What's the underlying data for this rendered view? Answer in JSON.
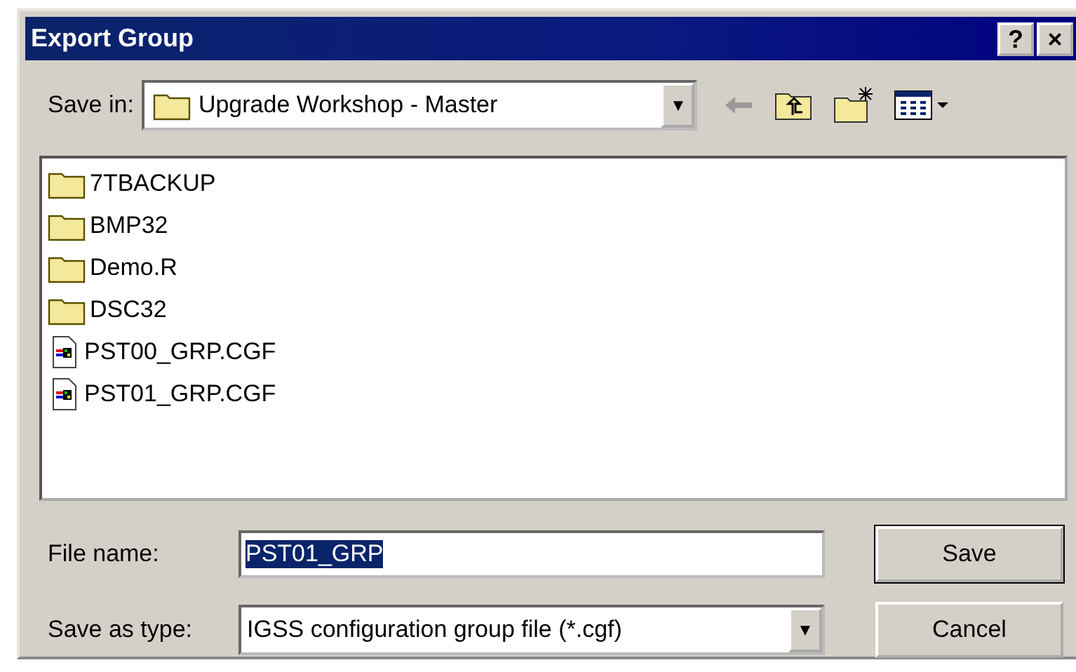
{
  "window": {
    "title": "Export Group",
    "buttons": [
      "?",
      "×"
    ]
  },
  "save_in": {
    "label": "Save in:",
    "value": "Upgrade Workshop - Master",
    "arrow": "▼"
  },
  "files": [
    {
      "name": "7TBACKUP",
      "kind": "folder"
    },
    {
      "name": "BMP32",
      "kind": "folder"
    },
    {
      "name": "Demo.R",
      "kind": "folder"
    },
    {
      "name": "DSC32",
      "kind": "folder"
    },
    {
      "name": "PST00_GRP.CGF",
      "kind": "cgf"
    },
    {
      "name": "PST01_GRP.CGF",
      "kind": "cgf"
    }
  ],
  "file_name": {
    "label": "File name:",
    "value": "PST01_GRP",
    "highlighted": true
  },
  "save_as_type": {
    "label": "Save as type:",
    "value": "IGSS configuration group file (*.cgf)",
    "arrow": "▼"
  },
  "buttons": [
    "Save",
    "Cancel"
  ]
}
